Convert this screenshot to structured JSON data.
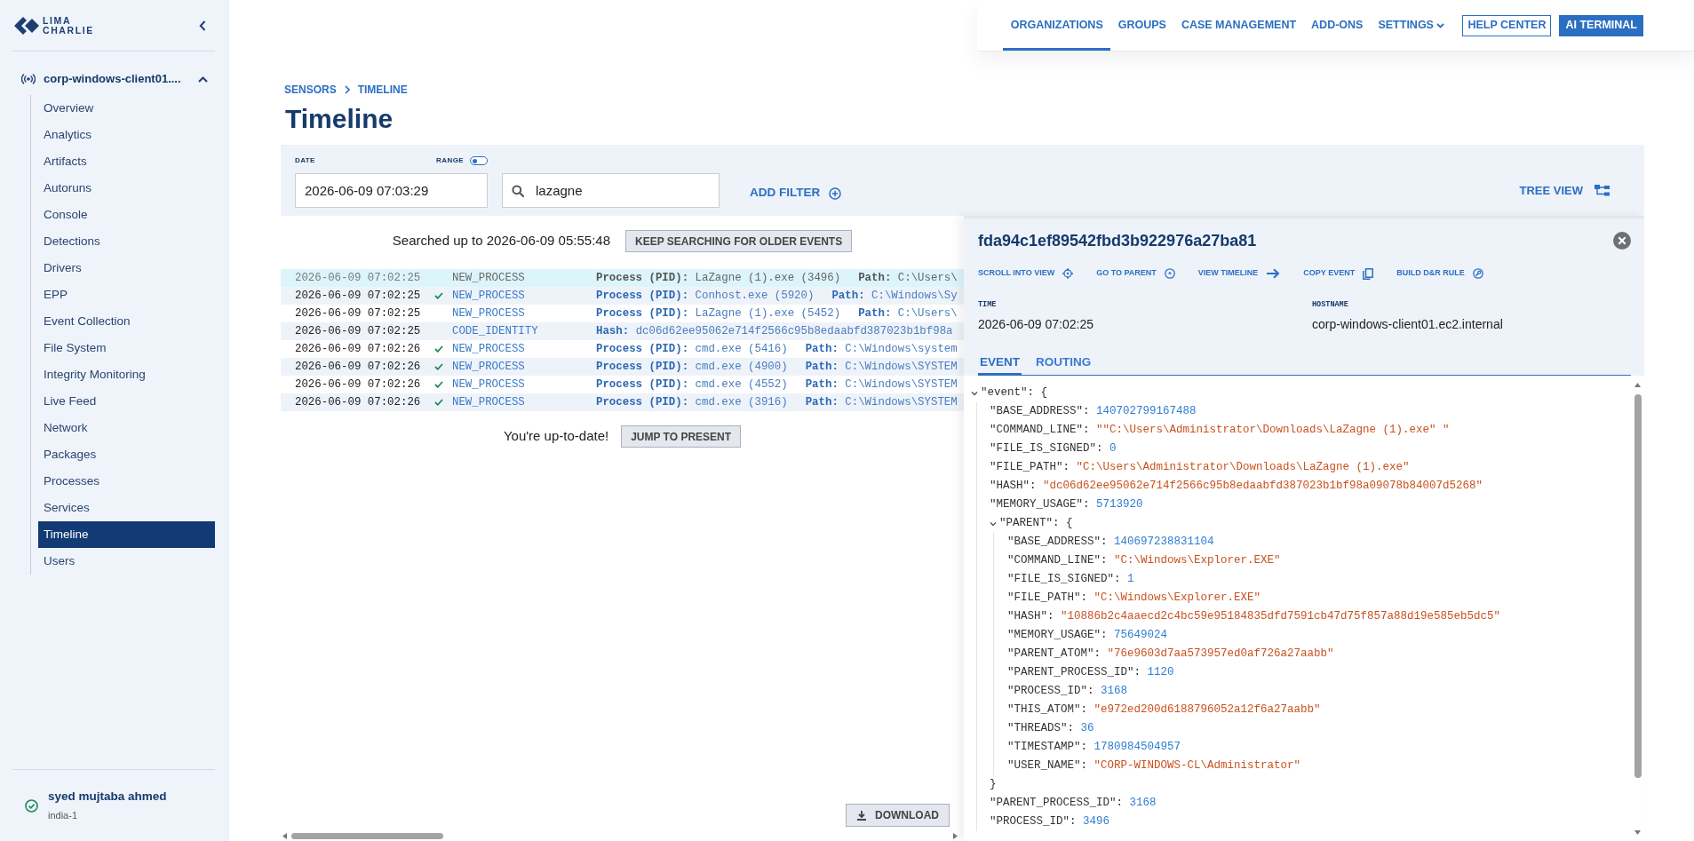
{
  "sidebar": {
    "logo": [
      "LIMA",
      "CHARLIE"
    ],
    "sensor": {
      "name": "corp-windows-client01....",
      "expanded": true
    },
    "items": [
      {
        "label": "Overview",
        "selected": false
      },
      {
        "label": "Analytics",
        "selected": false
      },
      {
        "label": "Artifacts",
        "selected": false
      },
      {
        "label": "Autoruns",
        "selected": false
      },
      {
        "label": "Console",
        "selected": false
      },
      {
        "label": "Detections",
        "selected": false
      },
      {
        "label": "Drivers",
        "selected": false
      },
      {
        "label": "EPP",
        "selected": false
      },
      {
        "label": "Event Collection",
        "selected": false
      },
      {
        "label": "File System",
        "selected": false
      },
      {
        "label": "Integrity Monitoring",
        "selected": false
      },
      {
        "label": "Live Feed",
        "selected": false
      },
      {
        "label": "Network",
        "selected": false
      },
      {
        "label": "Packages",
        "selected": false
      },
      {
        "label": "Processes",
        "selected": false
      },
      {
        "label": "Services",
        "selected": false
      },
      {
        "label": "Timeline",
        "selected": true
      },
      {
        "label": "Users",
        "selected": false
      }
    ],
    "user": {
      "name": "syed mujtaba ahmed",
      "region": "india-1",
      "online": true
    }
  },
  "top_nav": [
    {
      "label": "ORGANIZATIONS",
      "kind": "link",
      "selected": true
    },
    {
      "label": "GROUPS",
      "kind": "link",
      "selected": false
    },
    {
      "label": "CASE MANAGEMENT",
      "kind": "link",
      "selected": false
    },
    {
      "label": "ADD-ONS",
      "kind": "link",
      "selected": false
    },
    {
      "label": "SETTINGS",
      "kind": "dropdown",
      "selected": false
    },
    {
      "label": "HELP CENTER",
      "kind": "outline",
      "selected": false
    },
    {
      "label": "AI TERMINAL",
      "kind": "primary",
      "selected": false
    }
  ],
  "breadcrumb": [
    "SENSORS",
    "TIMELINE"
  ],
  "page_title": "Timeline",
  "filters": {
    "date": {
      "label": "DATE",
      "value": "2026-06-09 07:03:29"
    },
    "range": {
      "label": "RANGE",
      "on": false
    },
    "search": {
      "value": "lazagne"
    },
    "add_filter": "ADD FILTER",
    "tree_view": "TREE VIEW"
  },
  "results": {
    "status": "Searched up to 2026-06-09 05:55:48",
    "older_button": "KEEP SEARCHING FOR OLDER EVENTS",
    "rows": [
      {
        "time": "2026-06-09 07:02:25",
        "verified": false,
        "selected": true,
        "event_type": "NEW_PROCESS",
        "fields": [
          {
            "label": "Process (PID):",
            "value": "LaZagne (1).exe (3496)"
          },
          {
            "label": "Path:",
            "value": "C:\\Users\\"
          }
        ]
      },
      {
        "time": "2026-06-09 07:02:25",
        "verified": true,
        "selected": false,
        "event_type": "NEW_PROCESS",
        "fields": [
          {
            "label": "Process (PID):",
            "value": "Conhost.exe (5920)"
          },
          {
            "label": "Path:",
            "value": "C:\\Windows\\Sy"
          }
        ]
      },
      {
        "time": "2026-06-09 07:02:25",
        "verified": false,
        "selected": false,
        "event_type": "NEW_PROCESS",
        "fields": [
          {
            "label": "Process (PID):",
            "value": "LaZagne (1).exe (5452)"
          },
          {
            "label": "Path:",
            "value": "C:\\Users\\"
          }
        ]
      },
      {
        "time": "2026-06-09 07:02:25",
        "verified": false,
        "selected": false,
        "event_type": "CODE_IDENTITY",
        "fields": [
          {
            "label": "Hash:",
            "value": "dc06d62ee95062e714f2566c95b8edaabfd387023b1bf98a"
          }
        ]
      },
      {
        "time": "2026-06-09 07:02:26",
        "verified": true,
        "selected": false,
        "event_type": "NEW_PROCESS",
        "fields": [
          {
            "label": "Process (PID):",
            "value": "cmd.exe (5416)"
          },
          {
            "label": "Path:",
            "value": "C:\\Windows\\system"
          }
        ]
      },
      {
        "time": "2026-06-09 07:02:26",
        "verified": true,
        "selected": false,
        "event_type": "NEW_PROCESS",
        "fields": [
          {
            "label": "Process (PID):",
            "value": "cmd.exe (4900)"
          },
          {
            "label": "Path:",
            "value": "C:\\Windows\\SYSTEM"
          }
        ]
      },
      {
        "time": "2026-06-09 07:02:26",
        "verified": true,
        "selected": false,
        "event_type": "NEW_PROCESS",
        "fields": [
          {
            "label": "Process (PID):",
            "value": "cmd.exe (4552)"
          },
          {
            "label": "Path:",
            "value": "C:\\Windows\\SYSTEM"
          }
        ]
      },
      {
        "time": "2026-06-09 07:02:26",
        "verified": true,
        "selected": false,
        "event_type": "NEW_PROCESS",
        "fields": [
          {
            "label": "Process (PID):",
            "value": "cmd.exe (3916)"
          },
          {
            "label": "Path:",
            "value": "C:\\Windows\\SYSTEM"
          }
        ]
      }
    ],
    "end_status": "You're up-to-date!",
    "present_button": "JUMP TO PRESENT",
    "download_button": "DOWNLOAD"
  },
  "event_panel": {
    "title": "fda94c1ef89542fbd3b922976a27ba81",
    "actions": [
      {
        "label": "SCROLL INTO VIEW",
        "kind": "target"
      },
      {
        "label": "GO TO PARENT",
        "kind": "parent"
      },
      {
        "label": "VIEW TIMELINE",
        "kind": "arrow"
      },
      {
        "label": "COPY EVENT",
        "kind": "copy"
      },
      {
        "label": "BUILD D&R RULE",
        "kind": "rule"
      }
    ],
    "fields": [
      {
        "label": "TIME",
        "value": "2026-06-09 07:02:25"
      },
      {
        "label": "HOSTNAME",
        "value": "corp-windows-client01.ec2.internal"
      }
    ],
    "tabs": [
      {
        "label": "EVENT",
        "selected": true
      },
      {
        "label": "ROUTING",
        "selected": false
      }
    ],
    "json": [
      {
        "key": "\"event\":",
        "value": "{",
        "kind": "object",
        "expanded": true,
        "children": [
          {
            "key": "\"BASE_ADDRESS\":",
            "value": "140702799167488",
            "kind": "number"
          },
          {
            "key": "\"COMMAND_LINE\":",
            "value": "\"\"C:\\Users\\Administrator\\Downloads\\LaZagne (1).exe\" \"",
            "kind": "string"
          },
          {
            "key": "\"FILE_IS_SIGNED\":",
            "value": "0",
            "kind": "number"
          },
          {
            "key": "\"FILE_PATH\":",
            "value": "\"C:\\Users\\Administrator\\Downloads\\LaZagne (1).exe\"",
            "kind": "string"
          },
          {
            "key": "\"HASH\":",
            "value": "\"dc06d62ee95062e714f2566c95b8edaabfd387023b1bf98a09078b84007d5268\"",
            "kind": "string"
          },
          {
            "key": "\"MEMORY_USAGE\":",
            "value": "5713920",
            "kind": "number"
          },
          {
            "key": "\"PARENT\":",
            "value": "{",
            "kind": "object",
            "expanded": true,
            "close": "}",
            "children": [
              {
                "key": "\"BASE_ADDRESS\":",
                "value": "140697238831104",
                "kind": "number"
              },
              {
                "key": "\"COMMAND_LINE\":",
                "value": "\"C:\\Windows\\Explorer.EXE\"",
                "kind": "string"
              },
              {
                "key": "\"FILE_IS_SIGNED\":",
                "value": "1",
                "kind": "number"
              },
              {
                "key": "\"FILE_PATH\":",
                "value": "\"C:\\Windows\\Explorer.EXE\"",
                "kind": "string"
              },
              {
                "key": "\"HASH\":",
                "value": "\"10886b2c4aaecd2c4bc59e95184835dfd7591cb47d75f857a88d19e585eb5dc5\"",
                "kind": "string"
              },
              {
                "key": "\"MEMORY_USAGE\":",
                "value": "75649024",
                "kind": "number"
              },
              {
                "key": "\"PARENT_ATOM\":",
                "value": "\"76e9603d7aa573957ed0af726a27aabb\"",
                "kind": "string"
              },
              {
                "key": "\"PARENT_PROCESS_ID\":",
                "value": "1120",
                "kind": "number"
              },
              {
                "key": "\"PROCESS_ID\":",
                "value": "3168",
                "kind": "number"
              },
              {
                "key": "\"THIS_ATOM\":",
                "value": "\"e972ed200d6188796052a12f6a27aabb\"",
                "kind": "string"
              },
              {
                "key": "\"THREADS\":",
                "value": "36",
                "kind": "number"
              },
              {
                "key": "\"TIMESTAMP\":",
                "value": "1780984504957",
                "kind": "number"
              },
              {
                "key": "\"USER_NAME\":",
                "value": "\"CORP-WINDOWS-CL\\Administrator\"",
                "kind": "string"
              }
            ]
          },
          {
            "key": "\"PARENT_PROCESS_ID\":",
            "value": "3168",
            "kind": "number"
          },
          {
            "key": "\"PROCESS_ID\":",
            "value": "3496",
            "kind": "number"
          }
        ]
      }
    ]
  }
}
